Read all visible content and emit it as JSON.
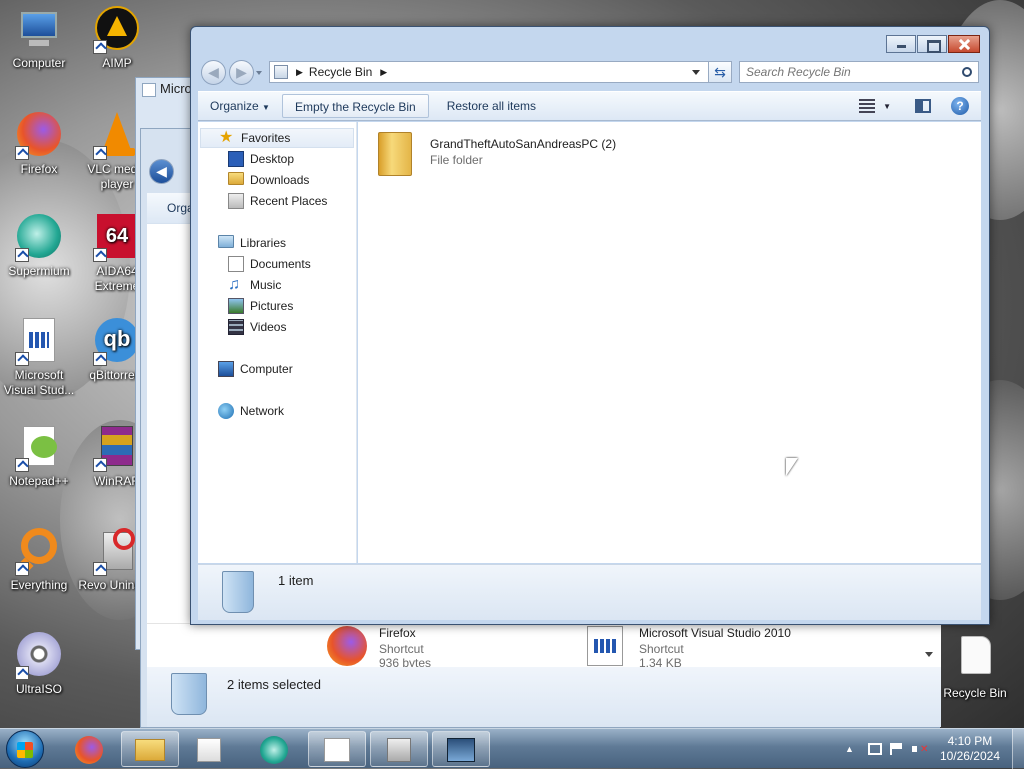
{
  "desktop": {
    "icons": [
      {
        "label": "Computer"
      },
      {
        "label": "AIMP"
      },
      {
        "label": "Firefox"
      },
      {
        "label": "VLC media player"
      },
      {
        "label": "Supermium"
      },
      {
        "label": "AIDA64 Extreme"
      },
      {
        "label": "Microsoft Visual Stud..."
      },
      {
        "label": "qBittorrent"
      },
      {
        "label": "Notepad++"
      },
      {
        "label": "WinRAR"
      },
      {
        "label": "Everything"
      },
      {
        "label": "Revo Uninstall"
      },
      {
        "label": "UltraISO"
      },
      {
        "label": "Recycle Bin"
      }
    ]
  },
  "bg_window1": {
    "title": "Micro"
  },
  "bg_window2": {
    "toolbar_label": "Orga",
    "files": [
      {
        "name": "Firefox",
        "type": "Shortcut",
        "size": "936 bytes"
      },
      {
        "name": "Microsoft Visual Studio 2010",
        "type": "Shortcut",
        "size": "1.34 KB"
      }
    ],
    "status": "2 items selected"
  },
  "window": {
    "breadcrumb": "Recycle Bin",
    "search_placeholder": "Search Recycle Bin",
    "toolbar": {
      "organize": "Organize",
      "empty": "Empty the Recycle Bin",
      "restore": "Restore all items"
    },
    "nav": {
      "favorites": "Favorites",
      "desktop": "Desktop",
      "downloads": "Downloads",
      "recent": "Recent Places",
      "libraries": "Libraries",
      "documents": "Documents",
      "music": "Music",
      "pictures": "Pictures",
      "videos": "Videos",
      "computer": "Computer",
      "network": "Network"
    },
    "items": [
      {
        "name": "GrandTheftAutoSanAndreasPC (2)",
        "type": "File folder"
      }
    ],
    "details_count": "1 item"
  },
  "taskbar": {
    "time": "4:10 PM",
    "date": "10/26/2024"
  },
  "colors": {
    "accent": "#1e395b",
    "titlebar": "#c4d7ee",
    "close": "#c64a30"
  }
}
